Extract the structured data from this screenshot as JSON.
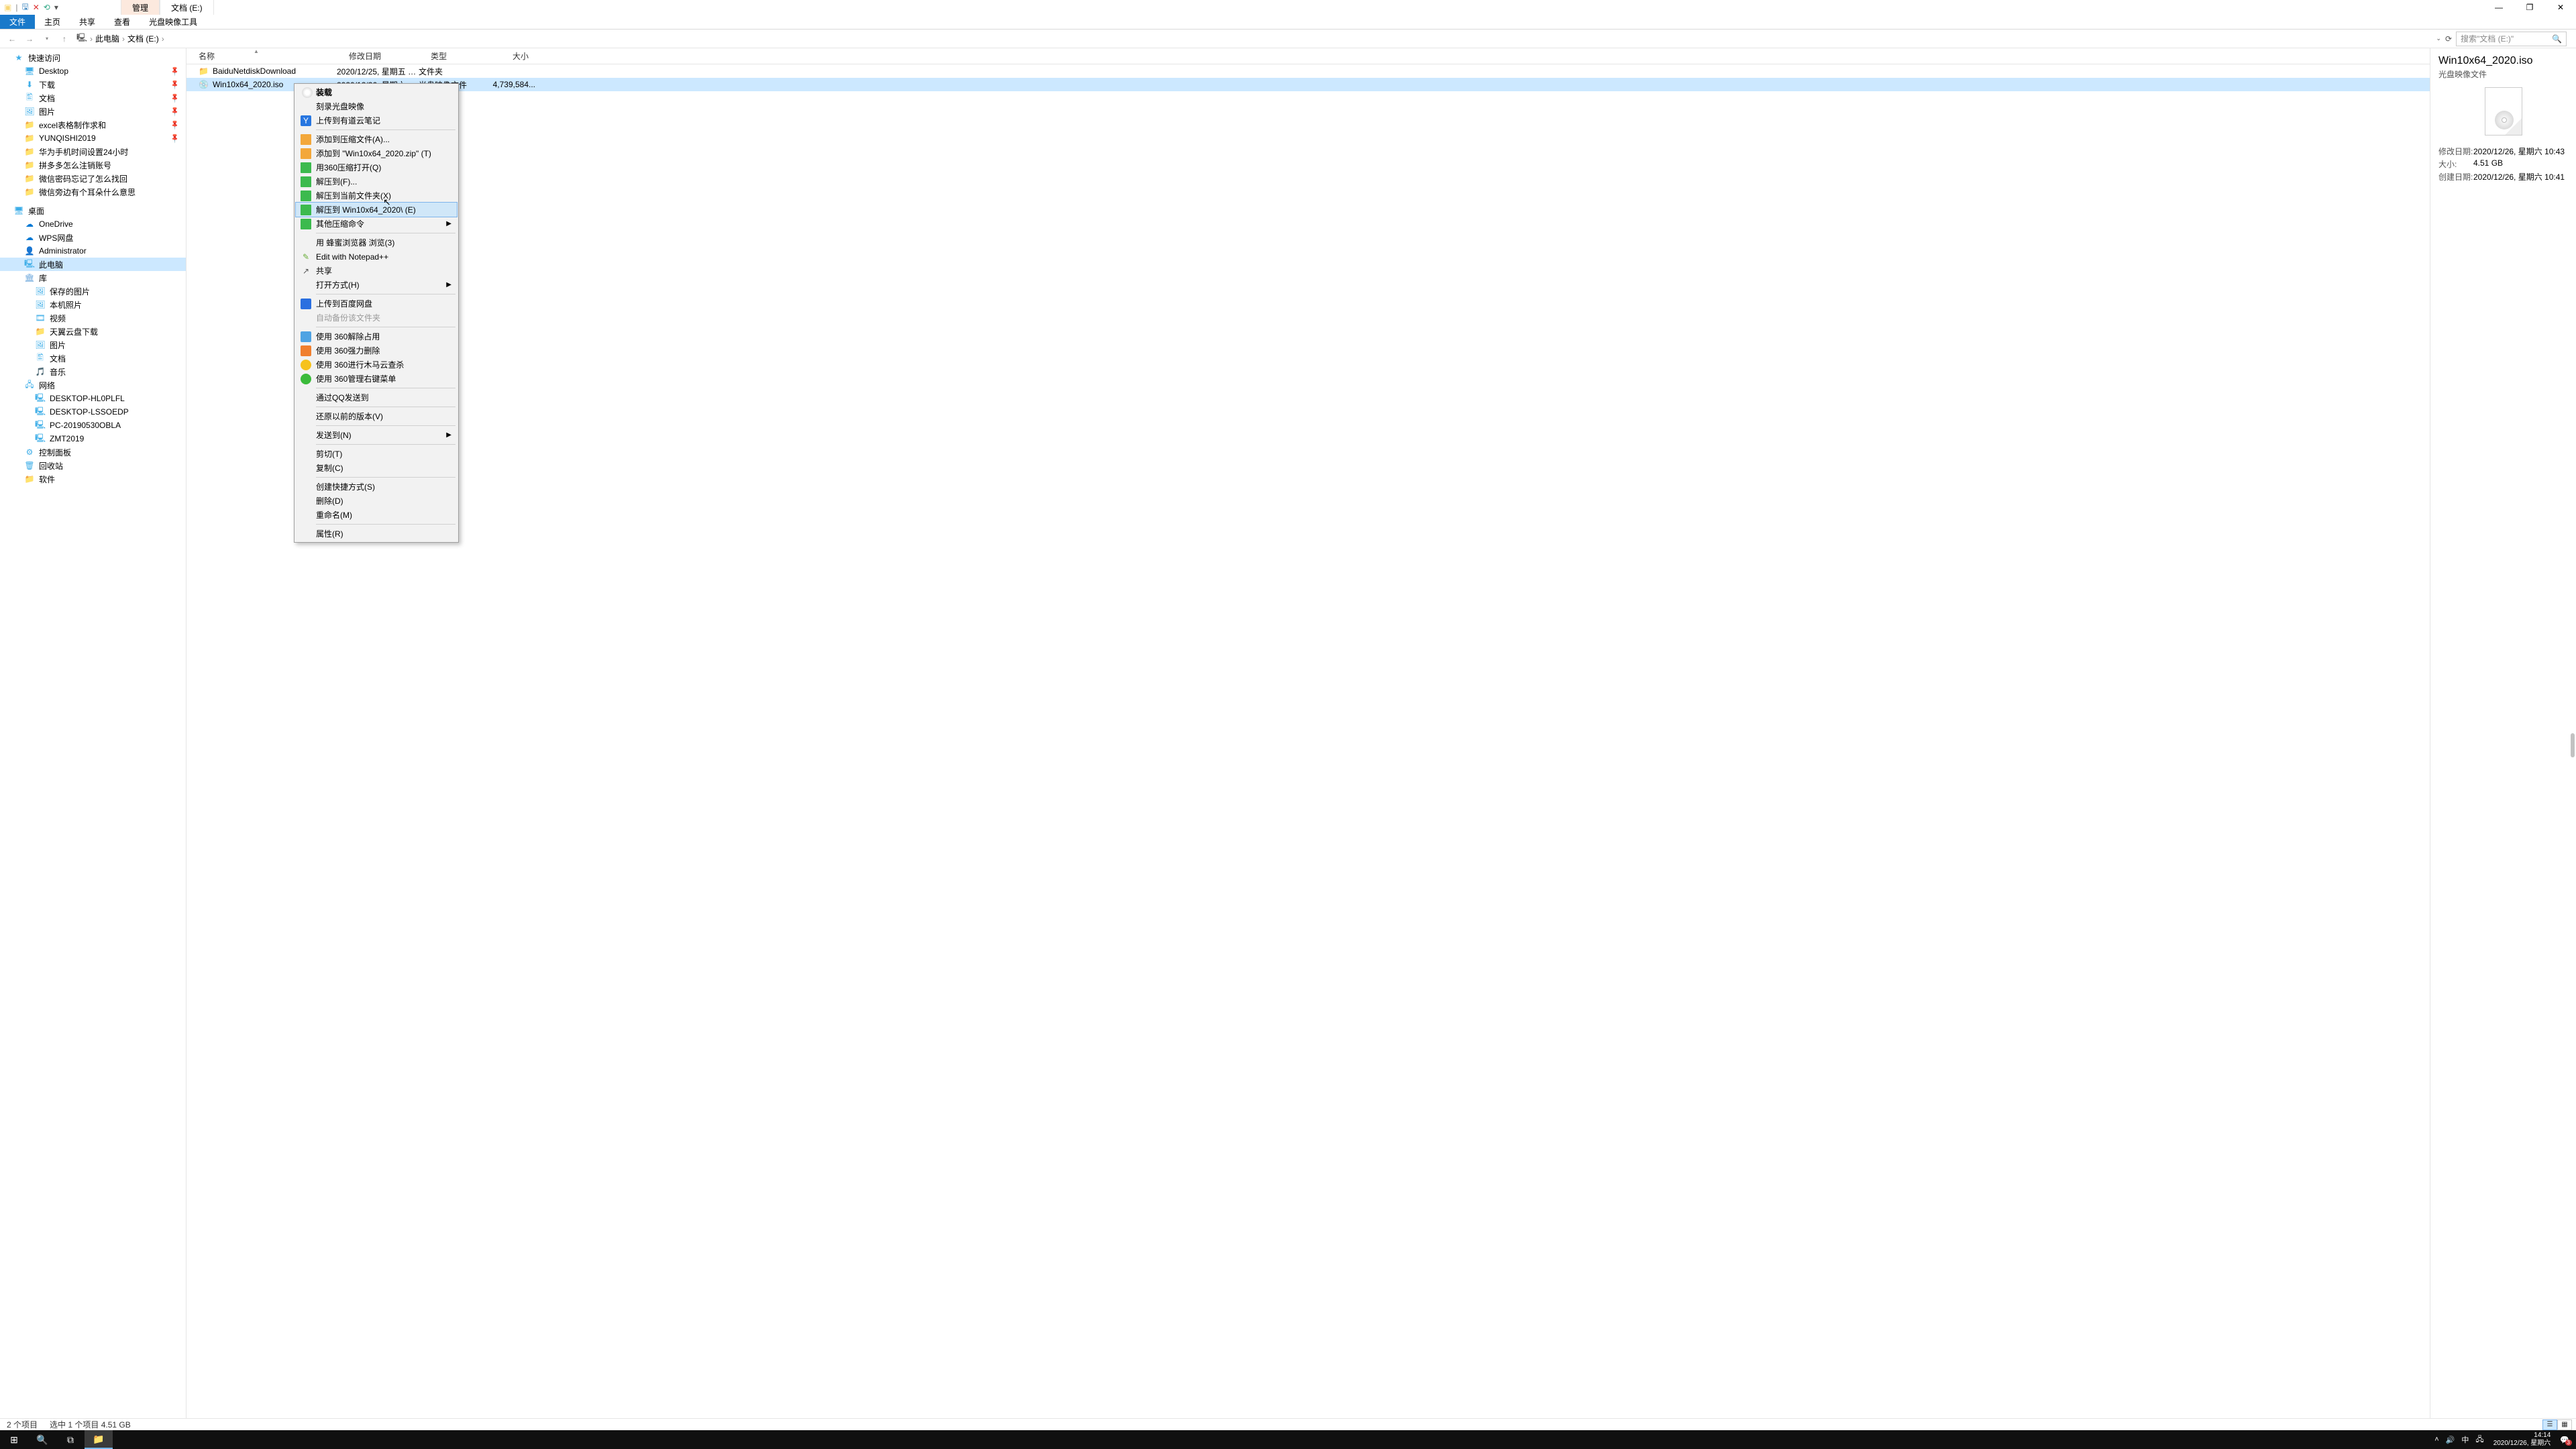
{
  "title_tabs": {
    "manage": "管理",
    "drive": "文档 (E:)"
  },
  "ribbon": {
    "file": "文件",
    "home": "主页",
    "share": "共享",
    "view": "查看",
    "disc": "光盘映像工具"
  },
  "breadcrumb": {
    "this_pc": "此电脑",
    "drive": "文档 (E:)"
  },
  "search": {
    "placeholder": "搜索\"文档 (E:)\""
  },
  "nav": {
    "quick": "快速访问",
    "desktop": "Desktop",
    "downloads": "下载",
    "documents": "文档",
    "pictures": "图片",
    "excel": "excel表格制作求和",
    "yunqishi": "YUNQISHI2019",
    "huawei": "华为手机时间设置24小时",
    "pinduoduo": "拼多多怎么注销账号",
    "wechat_pwd": "微信密码忘记了怎么找回",
    "wechat_ear": "微信旁边有个耳朵什么意思",
    "desktop2": "桌面",
    "onedrive": "OneDrive",
    "wps": "WPS网盘",
    "admin": "Administrator",
    "this_pc": "此电脑",
    "library": "库",
    "saved_pics": "保存的图片",
    "local_pics": "本机照片",
    "videos": "视频",
    "tianyi": "天翼云盘下载",
    "pictures2": "图片",
    "documents2": "文档",
    "music": "音乐",
    "network": "网络",
    "pc1": "DESKTOP-HL0PLFL",
    "pc2": "DESKTOP-LSSOEDP",
    "pc3": "PC-20190530OBLA",
    "pc4": "ZMT2019",
    "cpanel": "控制面板",
    "recycle": "回收站",
    "software": "软件"
  },
  "columns": {
    "name": "名称",
    "date": "修改日期",
    "type": "类型",
    "size": "大小"
  },
  "rows": [
    {
      "name": "BaiduNetdiskDownload",
      "date": "2020/12/25, 星期五 1...",
      "type": "文件夹",
      "size": "",
      "kind": "folder"
    },
    {
      "name": "Win10x64_2020.iso",
      "date": "2020/12/26, 星期六 1...",
      "type": "光盘映像文件",
      "size": "4,739,584...",
      "kind": "iso"
    }
  ],
  "details": {
    "filename": "Win10x64_2020.iso",
    "filetype": "光盘映像文件",
    "mod_label": "修改日期:",
    "mod_val": "2020/12/26, 星期六 10:43",
    "size_label": "大小:",
    "size_val": "4.51 GB",
    "create_label": "创建日期:",
    "create_val": "2020/12/26, 星期六 10:41"
  },
  "context": {
    "mount": "装载",
    "burn": "刻录光盘映像",
    "youdao": "上传到有道云笔记",
    "add_archive": "添加到压缩文件(A)...",
    "add_zip": "添加到 \"Win10x64_2020.zip\" (T)",
    "open_360": "用360压缩打开(Q)",
    "extract_to": "解压到(F)...",
    "extract_here": "解压到当前文件夹(X)",
    "extract_folder": "解压到 Win10x64_2020\\ (E)",
    "other_compress": "其他压缩命令",
    "honey": "用 蜂蜜浏览器 浏览(3)",
    "notepad": "Edit with Notepad++",
    "share": "共享",
    "open_with": "打开方式(H)",
    "baidu_upload": "上传到百度网盘",
    "auto_backup": "自动备份该文件夹",
    "s360_unlock": "使用 360解除占用",
    "s360_delete": "使用 360强力删除",
    "s360_scan": "使用 360进行木马云查杀",
    "s360_menu": "使用 360管理右键菜单",
    "qq_send": "通过QQ发送到",
    "restore": "还原以前的版本(V)",
    "send_to": "发送到(N)",
    "cut": "剪切(T)",
    "copy": "复制(C)",
    "shortcut": "创建快捷方式(S)",
    "delete": "删除(D)",
    "rename": "重命名(M)",
    "properties": "属性(R)"
  },
  "status": {
    "items": "2 个项目",
    "selected": "选中 1 个项目  4.51 GB"
  },
  "tray": {
    "ime": "中",
    "time": "14:14",
    "date": "2020/12/26, 星期六",
    "notif_count": "3"
  }
}
